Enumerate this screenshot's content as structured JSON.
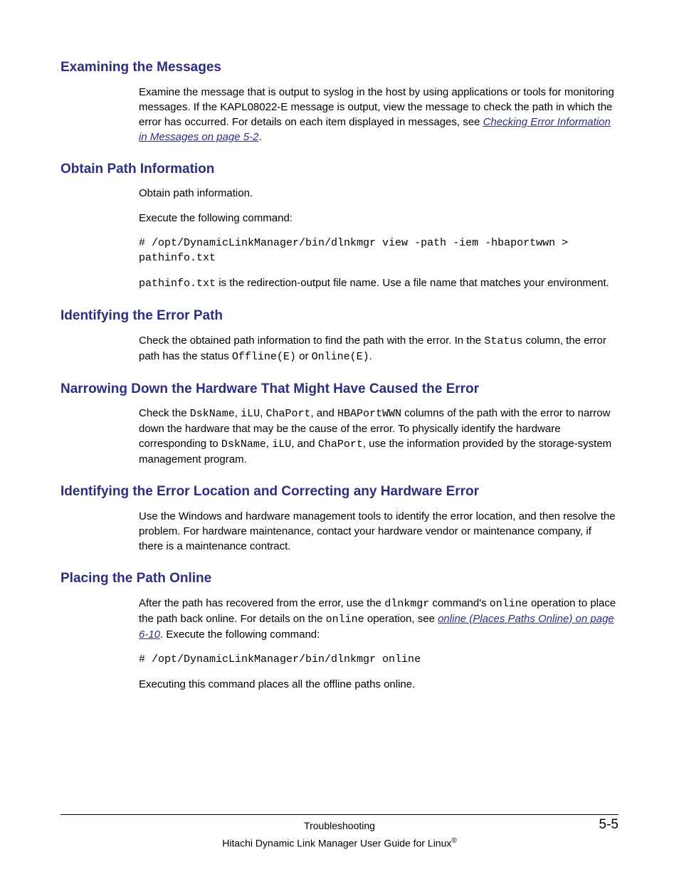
{
  "sections": {
    "examining": {
      "heading": "Examining the Messages",
      "p1a": "Examine the message that is output to syslog in the host by using applications or tools for monitoring messages. If the KAPL08022-E message is output, view the message to check the path in which the error has occurred. For details on each item displayed in messages, see ",
      "link": "Checking Error Information in Messages on page 5-2",
      "p1b": "."
    },
    "obtain": {
      "heading": "Obtain Path Information",
      "p1": "Obtain path information.",
      "p2": "Execute the following command:",
      "cmd": "# /opt/DynamicLinkManager/bin/dlnkmgr view -path -iem -hbaportwwn > pathinfo.txt",
      "p3a": "pathinfo.txt",
      "p3b": " is the redirection-output file name. Use a file name that matches your environment."
    },
    "identify_path": {
      "heading": "Identifying the Error Path",
      "p1a": "Check the obtained path information to find the path with the error. In the ",
      "c1": "Status",
      "p1b": " column, the error path has the status ",
      "c2": "Offline(E)",
      "p1c": " or ",
      "c3": "Online(E)",
      "p1d": "."
    },
    "narrow": {
      "heading": "Narrowing Down the Hardware That Might Have Caused the Error",
      "p1a": "Check the ",
      "c1": "DskName",
      "p1b": ", ",
      "c2": "iLU",
      "p1c": ", ",
      "c3": "ChaPort",
      "p1d": ", and ",
      "c4": "HBAPortWWN",
      "p1e": " columns of the path with the error to narrow down the hardware that may be the cause of the error. To physically identify the hardware corresponding to ",
      "c5": "DskName",
      "p1f": ", ",
      "c6": "iLU",
      "p1g": ", and ",
      "c7": "ChaPort",
      "p1h": ", use the information provided by the storage-system management program."
    },
    "identify_loc": {
      "heading": "Identifying the Error Location and Correcting any Hardware Error",
      "p1": "Use the Windows and hardware management tools to identify the error location, and then resolve the problem. For hardware maintenance, contact your hardware vendor or maintenance company, if there is a maintenance contract."
    },
    "placing": {
      "heading": "Placing the Path Online",
      "p1a": "After the path has recovered from the error, use the ",
      "c1": "dlnkmgr",
      "p1b": " command's ",
      "c2": "online",
      "p1c": " operation to place the path back online. For details on the ",
      "c3": "online",
      "p1d": " operation, see ",
      "link": "online (Places Paths Online) on page 6-10",
      "p1e": ". Execute the following command:",
      "cmd": "# /opt/DynamicLinkManager/bin/dlnkmgr online",
      "p2": "Executing this command places all the offline paths online."
    }
  },
  "footer": {
    "section": "Troubleshooting",
    "page": "5-5",
    "book": "Hitachi Dynamic Link Manager User Guide for Linux"
  }
}
